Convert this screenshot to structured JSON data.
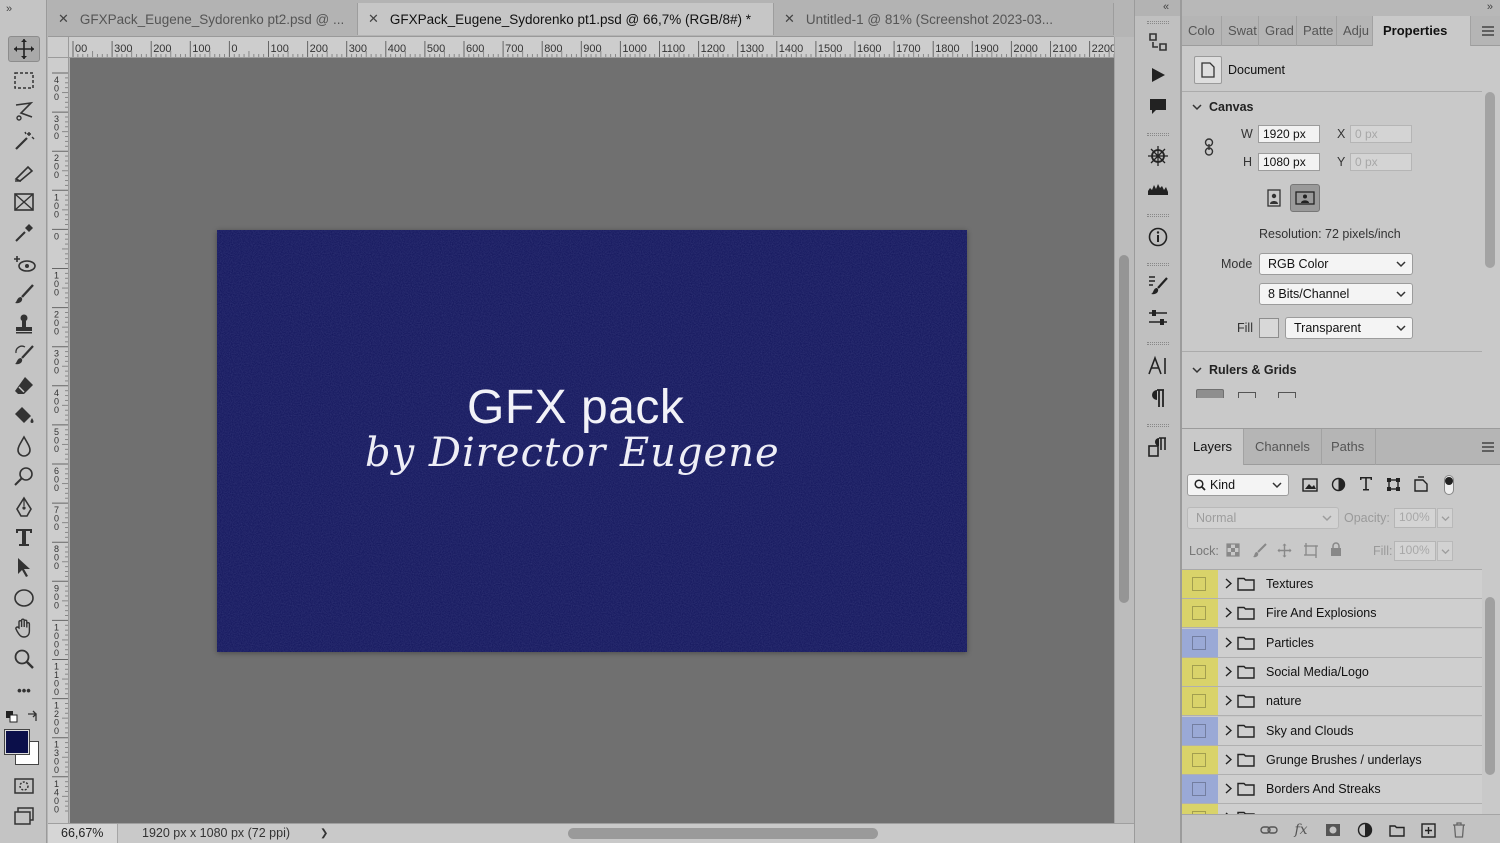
{
  "toolbar": {
    "grip": "»",
    "tools": [
      "move-tool",
      "rectangular-marquee-tool",
      "lasso-tool",
      "magic-wand-tool",
      "eyedropper-tool",
      "frame-tool",
      "eyedropper-alt-tool",
      "spot-healing-tool",
      "brush-tool",
      "clone-stamp-tool",
      "history-brush-tool",
      "eraser-tool",
      "paint-bucket-tool",
      "blur-tool",
      "dodge-tool",
      "pen-tool",
      "type-tool",
      "path-selection-tool",
      "ellipse-tool",
      "hand-tool",
      "zoom-tool",
      "more-tools"
    ],
    "foreground_color": "#0b0f4a",
    "background_color": "#ffffff",
    "more_label": "•••"
  },
  "document_tabs": [
    {
      "title": "GFXPack_Eugene_Sydorenko pt2.psd @ ...",
      "active": false
    },
    {
      "title": "GFXPack_Eugene_Sydorenko pt1.psd @ 66,7% (RGB/8#) *",
      "active": true
    },
    {
      "title": "Untitled-1 @ 81% (Screenshot 2023-03...",
      "active": false
    }
  ],
  "ruler": {
    "h_labels": [
      "00",
      "300",
      "200",
      "100",
      "0",
      "100",
      "200",
      "300",
      "400",
      "500",
      "600",
      "700",
      "800",
      "900",
      "1000",
      "1100",
      "1200",
      "1300",
      "1400",
      "1500",
      "1600",
      "1700",
      "1800",
      "1900",
      "2000",
      "2100",
      "2200"
    ],
    "v_labels": [
      "400",
      "300",
      "200",
      "100",
      "0",
      "100",
      "200",
      "300",
      "400",
      "500",
      "600",
      "700",
      "800",
      "900",
      "1000",
      "1100",
      "1200",
      "1300",
      "1400"
    ]
  },
  "canvas": {
    "background": "#10135a",
    "title": "GFX pack",
    "subtitle": "by Director Eugene"
  },
  "status": {
    "zoom": "66,67%",
    "doc_info": "1920 px x 1080 px (72 ppi)",
    "arrow": "❯"
  },
  "properties": {
    "collapse": "«",
    "expand": "»",
    "tabs": [
      "Colo",
      "Swat",
      "Grad",
      "Patte",
      "Adju",
      "Properties"
    ],
    "document_label": "Document",
    "canvas_section": "Canvas",
    "w_label": "W",
    "w_value": "1920 px",
    "h_label": "H",
    "h_value": "1080 px",
    "x_label": "X",
    "x_value": "0 px",
    "y_label": "Y",
    "y_value": "0 px",
    "resolution": "Resolution: 72 pixels/inch",
    "mode_label": "Mode",
    "mode_value": "RGB Color",
    "bits_value": "8 Bits/Channel",
    "fill_label": "Fill",
    "fill_value": "Transparent",
    "rulers_section": "Rulers & Grids"
  },
  "layers_panel": {
    "tabs": [
      "Layers",
      "Channels",
      "Paths"
    ],
    "kind_label": "Kind",
    "blend_mode": "Normal",
    "opacity_label": "Opacity:",
    "opacity_value": "100%",
    "lock_label": "Lock:",
    "fill_label": "Fill:",
    "fill_value": "100%",
    "fx_label": "fx",
    "layers": [
      {
        "name": "Textures",
        "color": "#d9d36a"
      },
      {
        "name": "Fire And Explosions",
        "color": "#d9d36a"
      },
      {
        "name": "Particles",
        "color": "#9aa9d6"
      },
      {
        "name": "Social Media/Logo",
        "color": "#d9d36a"
      },
      {
        "name": "nature",
        "color": "#d9d36a"
      },
      {
        "name": "Sky and Clouds",
        "color": "#9aa9d6"
      },
      {
        "name": "Grunge Brushes / underlays",
        "color": "#d9d36a"
      },
      {
        "name": "Borders And Streaks",
        "color": "#9aa9d6"
      },
      {
        "name": "",
        "color": "#d9d36a"
      }
    ]
  }
}
